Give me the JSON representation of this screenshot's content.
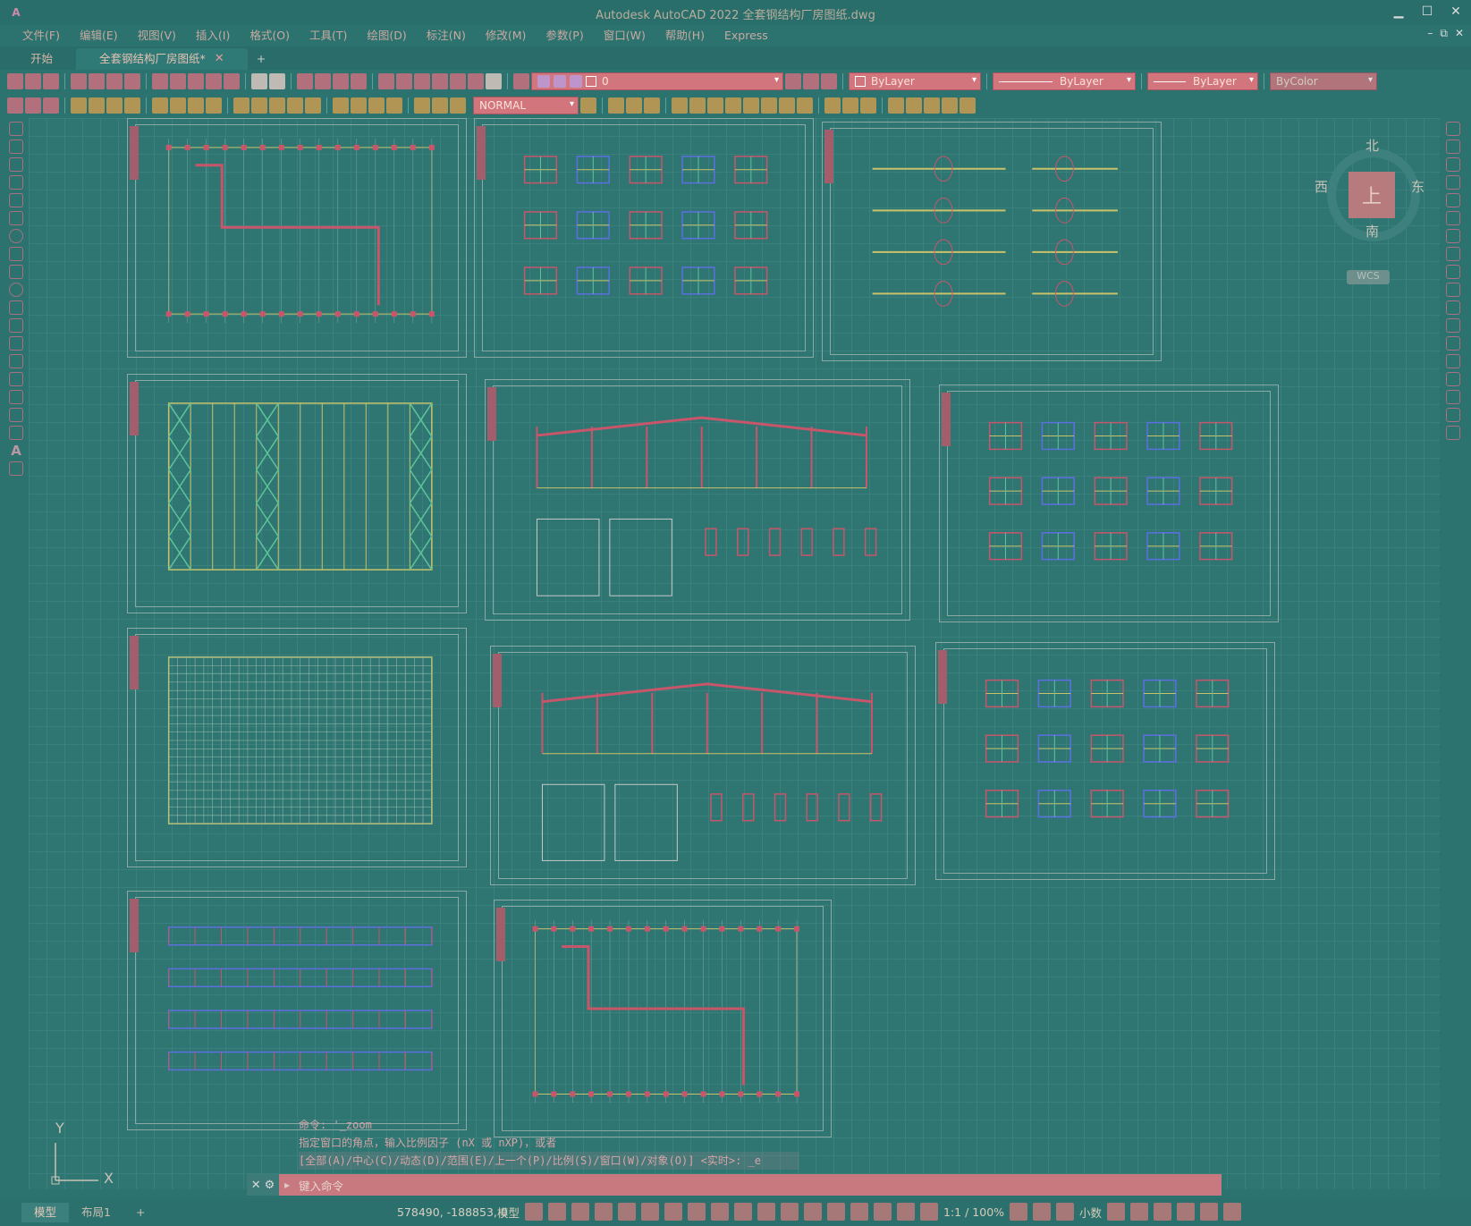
{
  "window": {
    "title": "Autodesk AutoCAD 2022    全套钢结构厂房图纸.dwg",
    "logo": "A",
    "controls": {
      "minimize": "▁",
      "maximize": "☐",
      "close": "✕"
    }
  },
  "menu": {
    "items": [
      "文件(F)",
      "编辑(E)",
      "视图(V)",
      "插入(I)",
      "格式(O)",
      "工具(T)",
      "绘图(D)",
      "标注(N)",
      "修改(M)",
      "参数(P)",
      "窗口(W)",
      "帮助(H)",
      "Express"
    ],
    "mdi": {
      "minimize": "–",
      "restore": "⧉",
      "close": "✕"
    }
  },
  "tabs": {
    "start": "开始",
    "active": "全套钢结构厂房图纸*",
    "close": "✕",
    "add": "+"
  },
  "toolbar": {
    "layer_value": "0",
    "visual_style": "NORMAL",
    "color": "ByLayer",
    "linetype": "ByLayer",
    "lineweight": "ByLayer",
    "plotstyle": "ByColor"
  },
  "viewcube": {
    "north": "北",
    "south": "南",
    "east": "东",
    "west": "西",
    "top": "上",
    "wcs": "WCS"
  },
  "ucs": {
    "x": "X",
    "y": "Y"
  },
  "command": {
    "history": [
      "命令: '_zoom",
      "指定窗口的角点，输入比例因子 (nX 或 nXP)，或者",
      "[全部(A)/中心(C)/动态(D)/范围(E)/上一个(P)/比例(S)/窗口(W)/对象(O)] <实时>: _e"
    ],
    "placeholder": "键入命令"
  },
  "status": {
    "model_tab": "模型",
    "layout_tab": "布局1",
    "add": "+",
    "coords": "578490, -188853, 0",
    "model": "模型",
    "scale": "1:1 / 100%",
    "units": "小数"
  },
  "colors": {
    "canvas": "#2f7673",
    "accent": "#c8797f",
    "sheet_border": "#8aa9a5",
    "drawing_red": "#c8556a",
    "drawing_yellow": "#c9c26a",
    "drawing_green": "#5fc39a",
    "drawing_blue": "#5c6fe0"
  }
}
